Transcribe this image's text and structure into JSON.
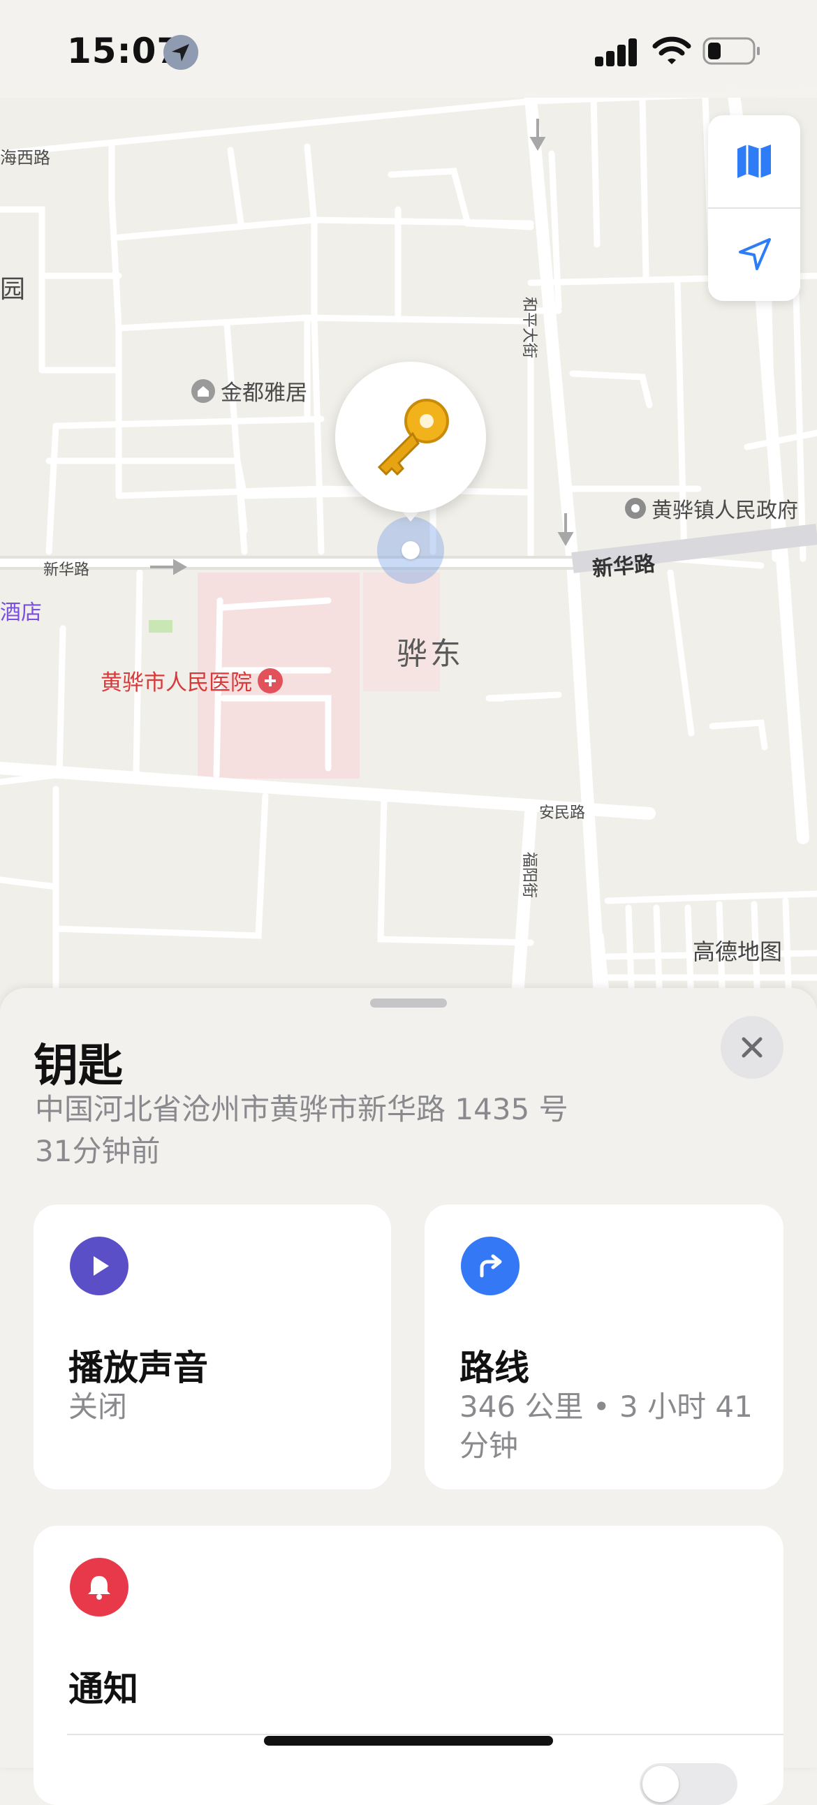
{
  "status_bar": {
    "time": "15:07",
    "location_icon": "location-arrow-icon",
    "signal_icon": "cellular-signal-icon",
    "wifi_icon": "wifi-icon",
    "battery_icon": "battery-icon"
  },
  "map": {
    "labels": {
      "jindu": "金都雅居",
      "road_xinhua_left": "新华路",
      "road_xinhua_right": "新华路",
      "road_heping": "和平大街",
      "gov": "黄骅镇人民政府",
      "district": "骅东",
      "hospital": "黄骅市人民医院",
      "road_anmin": "安民路",
      "road_fuyang": "福阳街",
      "road_top_left": "海西路",
      "edge_yuan": "园",
      "edge_dian": "酒店",
      "provider": "高德地图"
    },
    "controls": {
      "map_mode_icon": "map-icon",
      "locate_icon": "location-arrow-icon"
    },
    "pin_icon": "key-icon"
  },
  "item": {
    "title": "钥匙",
    "address": "中国河北省沧州市黄骅市新华路 1435 号",
    "updated": "31分钟前"
  },
  "actions": {
    "play_sound": {
      "title": "播放声音",
      "subtitle": "关闭",
      "icon": "play-icon",
      "color": "#5b4fc7"
    },
    "directions": {
      "title": "路线",
      "subtitle": "346 公里 • 3 小时 41 分钟",
      "icon": "turn-right-icon",
      "color": "#3478f6"
    },
    "notifications": {
      "title": "通知",
      "icon": "bell-icon",
      "color": "#e8394a"
    }
  }
}
